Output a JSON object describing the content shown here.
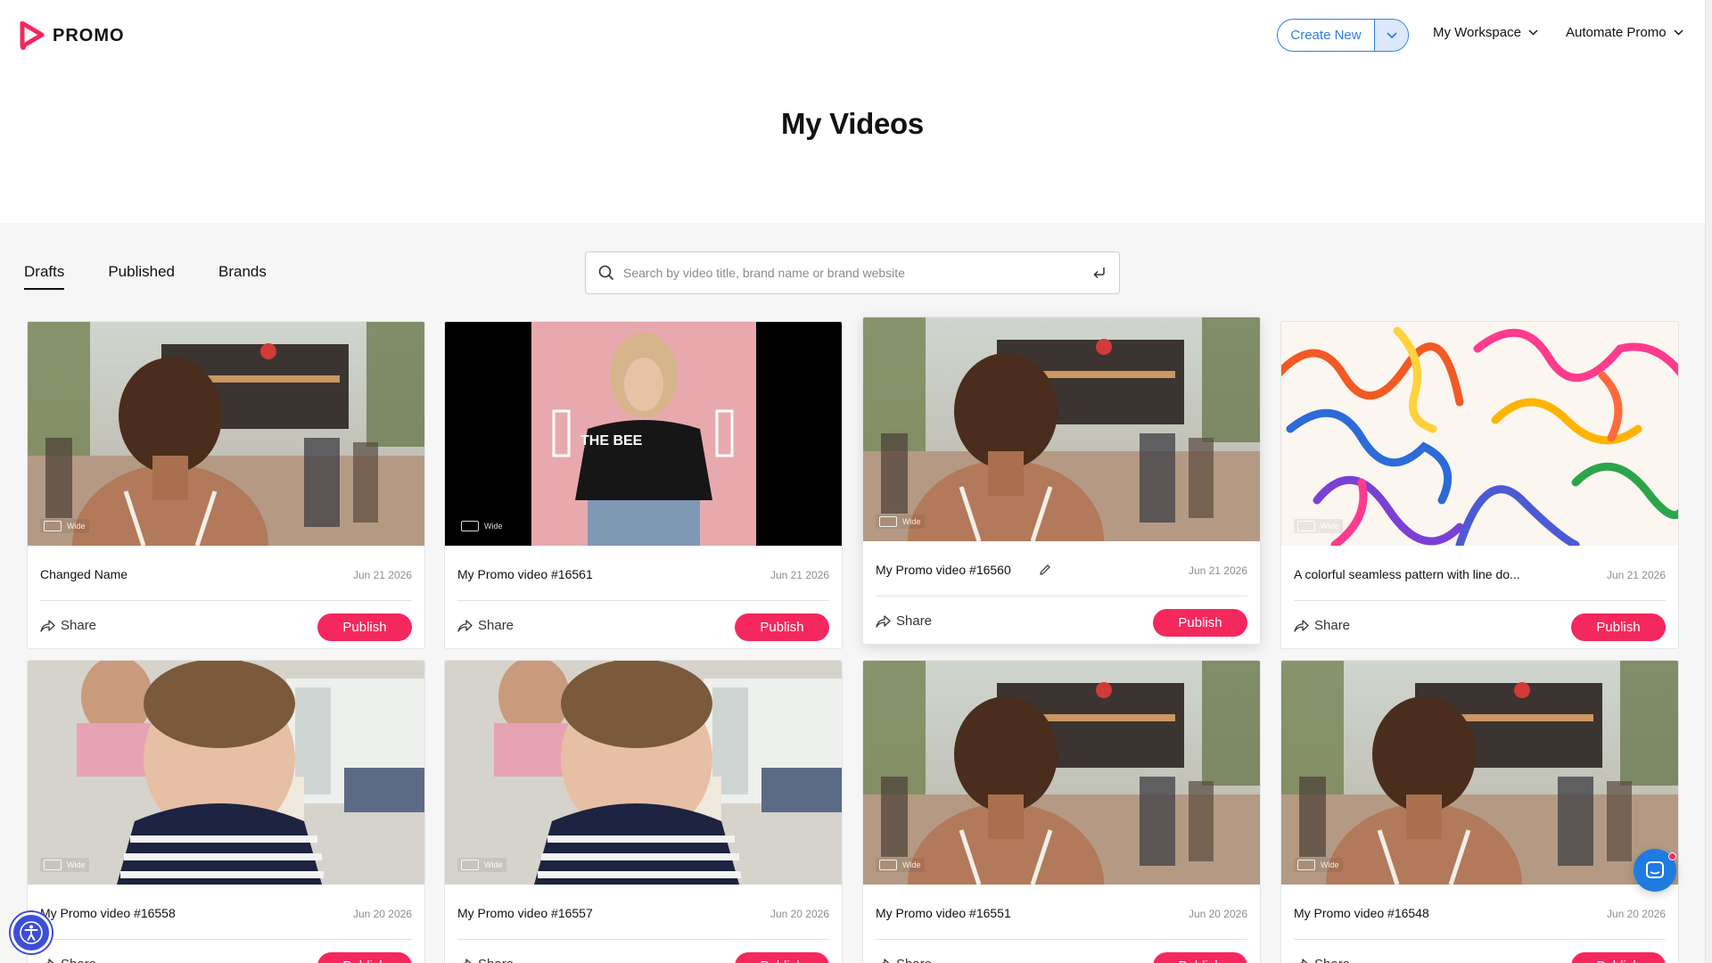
{
  "header": {
    "logo_text": "PROMO",
    "create_new_label": "Create New",
    "workspace_label": "My Workspace",
    "automate_label": "Automate Promo"
  },
  "page_title": "My Videos",
  "tabs": [
    {
      "label": "Drafts",
      "active": true
    },
    {
      "label": "Published",
      "active": false
    },
    {
      "label": "Brands",
      "active": false
    }
  ],
  "search": {
    "placeholder": "Search by video title, brand name or brand website"
  },
  "card_labels": {
    "wide": "Wide",
    "share": "Share",
    "publish": "Publish"
  },
  "cards": [
    {
      "title": "Changed Name",
      "date": "Jun 21 2026",
      "thumb": "festival"
    },
    {
      "title": "My Promo video #16561",
      "date": "Jun 21 2026",
      "thumb": "model-the-bee"
    },
    {
      "title": "My Promo video #16560",
      "date": "Jun 21 2026",
      "thumb": "festival",
      "hovered": true
    },
    {
      "title": "A colorful seamless pattern with line do...",
      "date": "Jun 21 2026",
      "thumb": "colorful-lines"
    },
    {
      "title": "My Promo video #16558",
      "date": "Jun 20 2026",
      "thumb": "child"
    },
    {
      "title": "My Promo video #16557",
      "date": "Jun 20 2026",
      "thumb": "child"
    },
    {
      "title": "My Promo video #16551",
      "date": "Jun 20 2026",
      "thumb": "festival"
    },
    {
      "title": "My Promo video #16548",
      "date": "Jun 20 2026",
      "thumb": "festival"
    }
  ],
  "thumb_overlay_text": "THE BEE",
  "colors": {
    "accent_pink": "#f5285e",
    "accent_blue": "#2f7fe0",
    "accessibility_blue": "#3d4ed8"
  }
}
